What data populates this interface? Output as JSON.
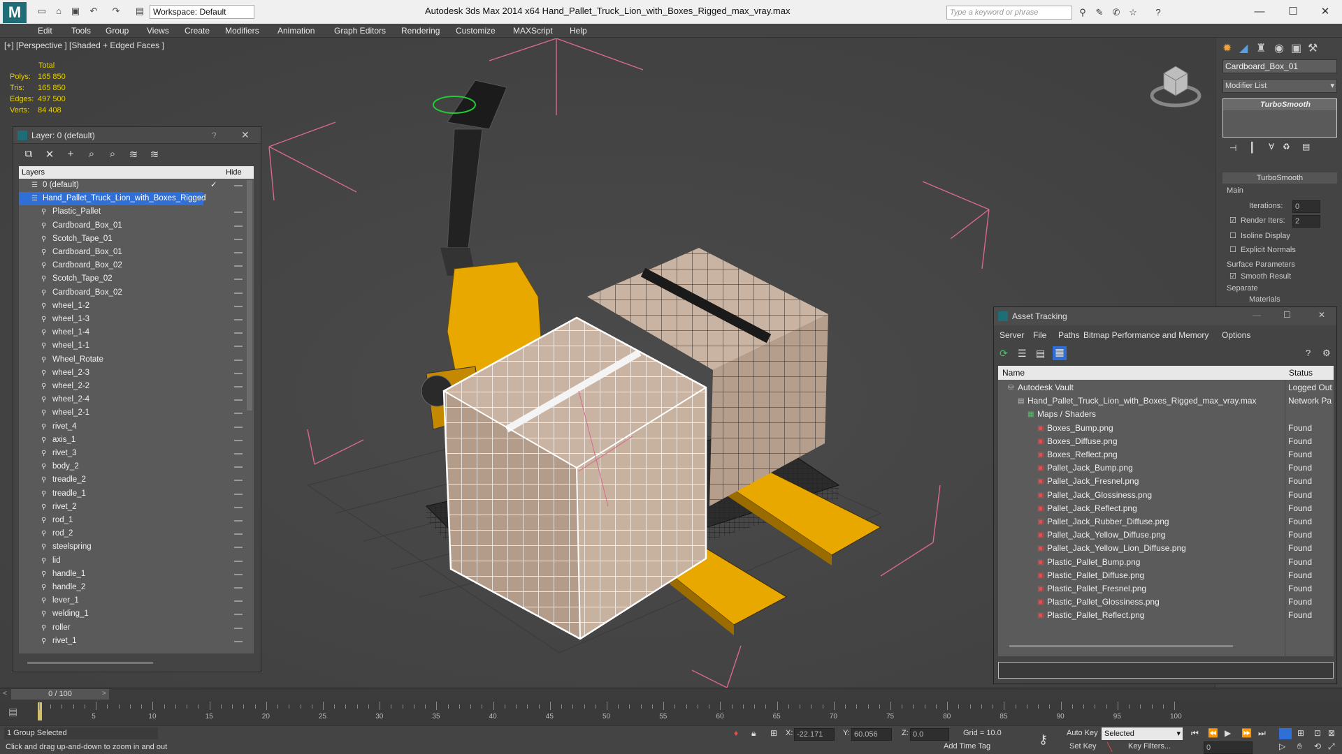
{
  "titlebar": {
    "workspace": "Workspace: Default",
    "app_title": "Autodesk 3ds Max  2014 x64     Hand_Pallet_Truck_Lion_with_Boxes_Rigged_max_vray.max",
    "search_placeholder": "Type a keyword or phrase"
  },
  "menu": [
    "Edit",
    "Tools",
    "Group",
    "Views",
    "Create",
    "Modifiers",
    "Animation",
    "Graph Editors",
    "Rendering",
    "Customize",
    "MAXScript",
    "Help"
  ],
  "viewport": {
    "label": "[+] [Perspective ] [Shaded + Edged Faces ]",
    "stats": {
      "header": "Total",
      "polys_label": "Polys:",
      "polys": "165 850",
      "tris_label": "Tris:",
      "tris": "165 850",
      "edges_label": "Edges:",
      "edges": "497 500",
      "verts_label": "Verts:",
      "verts": "84 408"
    }
  },
  "layer_panel": {
    "title": "Layer: 0 (default)",
    "help": "?",
    "col_layers": "Layers",
    "col_hide": "Hide",
    "layers": [
      "0 (default)",
      "Hand_Pallet_Truck_Lion_with_Boxes_Rigged",
      "Plastic_Pallet",
      "Cardboard_Box_01",
      "Scotch_Tape_01",
      "Cardboard_Box_01",
      "Cardboard_Box_02",
      "Scotch_Tape_02",
      "Cardboard_Box_02",
      "wheel_1-2",
      "wheel_1-3",
      "wheel_1-4",
      "wheel_1-1",
      "Wheel_Rotate",
      "wheel_2-3",
      "wheel_2-2",
      "wheel_2-4",
      "wheel_2-1",
      "rivet_4",
      "axis_1",
      "rivet_3",
      "body_2",
      "treadle_2",
      "treadle_1",
      "rivet_2",
      "rod_1",
      "rod_2",
      "steelspring",
      "lid",
      "handle_1",
      "handle_2",
      "lever_1",
      "welding_1",
      "roller",
      "rivet_1"
    ]
  },
  "command_panel": {
    "object_name": "Cardboard_Box_01",
    "modifier_list": "Modifier List",
    "modifier": "TurboSmooth",
    "rollout": "TurboSmooth",
    "main": "Main",
    "iterations_label": "Iterations:",
    "iterations": "0",
    "render_iters_label": "Render Iters:",
    "render_iters": "2",
    "isoline": "Isoline Display",
    "explicit_normals": "Explicit Normals",
    "surface_params": "Surface Parameters",
    "smooth_result": "Smooth Result",
    "separate": "Separate",
    "materials": "Materials"
  },
  "asset_tracking": {
    "title": "Asset Tracking",
    "menu": [
      "Server",
      "File",
      "Paths",
      "Bitmap Performance and Memory",
      "Options"
    ],
    "col_name": "Name",
    "col_status": "Status",
    "rows": [
      {
        "name": "Autodesk Vault",
        "status": "Logged Out",
        "indent": 1
      },
      {
        "name": "Hand_Pallet_Truck_Lion_with_Boxes_Rigged_max_vray.max",
        "status": "Network Pa",
        "indent": 2
      },
      {
        "name": "Maps / Shaders",
        "status": "",
        "indent": 3
      },
      {
        "name": "Boxes_Bump.png",
        "status": "Found",
        "indent": 4
      },
      {
        "name": "Boxes_Diffuse.png",
        "status": "Found",
        "indent": 4
      },
      {
        "name": "Boxes_Reflect.png",
        "status": "Found",
        "indent": 4
      },
      {
        "name": "Pallet_Jack_Bump.png",
        "status": "Found",
        "indent": 4
      },
      {
        "name": "Pallet_Jack_Fresnel.png",
        "status": "Found",
        "indent": 4
      },
      {
        "name": "Pallet_Jack_Glossiness.png",
        "status": "Found",
        "indent": 4
      },
      {
        "name": "Pallet_Jack_Reflect.png",
        "status": "Found",
        "indent": 4
      },
      {
        "name": "Pallet_Jack_Rubber_Diffuse.png",
        "status": "Found",
        "indent": 4
      },
      {
        "name": "Pallet_Jack_Yellow_Diffuse.png",
        "status": "Found",
        "indent": 4
      },
      {
        "name": "Pallet_Jack_Yellow_Lion_Diffuse.png",
        "status": "Found",
        "indent": 4
      },
      {
        "name": "Plastic_Pallet_Bump.png",
        "status": "Found",
        "indent": 4
      },
      {
        "name": "Plastic_Pallet_Diffuse.png",
        "status": "Found",
        "indent": 4
      },
      {
        "name": "Plastic_Pallet_Fresnel.png",
        "status": "Found",
        "indent": 4
      },
      {
        "name": "Plastic_Pallet_Glossiness.png",
        "status": "Found",
        "indent": 4
      },
      {
        "name": "Plastic_Pallet_Reflect.png",
        "status": "Found",
        "indent": 4
      }
    ]
  },
  "timeline": {
    "frame": "0 / 100",
    "ticks": [
      "5",
      "10",
      "15",
      "20",
      "25",
      "30",
      "35",
      "40",
      "45",
      "50",
      "55",
      "60",
      "65",
      "70",
      "75",
      "80",
      "85",
      "90",
      "95",
      "100"
    ]
  },
  "status": {
    "selection": "1 Group Selected",
    "prompt": "Click and drag up-and-down to zoom in and out",
    "x_label": "X:",
    "x": "-22.171",
    "y_label": "Y:",
    "y": "60.056",
    "z_label": "Z:",
    "z": "0.0",
    "grid": "Grid = 10.0",
    "auto_key": "Auto Key",
    "set_key": "Set Key",
    "selected": "Selected",
    "key_filters": "Key Filters...",
    "add_time_tag": "Add Time Tag",
    "frame_field": "0"
  },
  "colors": {
    "box_face": "#c9b3a2",
    "yellow": "#e8a800",
    "bbox": "#d86a8a",
    "selection": "#2f6fd6"
  }
}
